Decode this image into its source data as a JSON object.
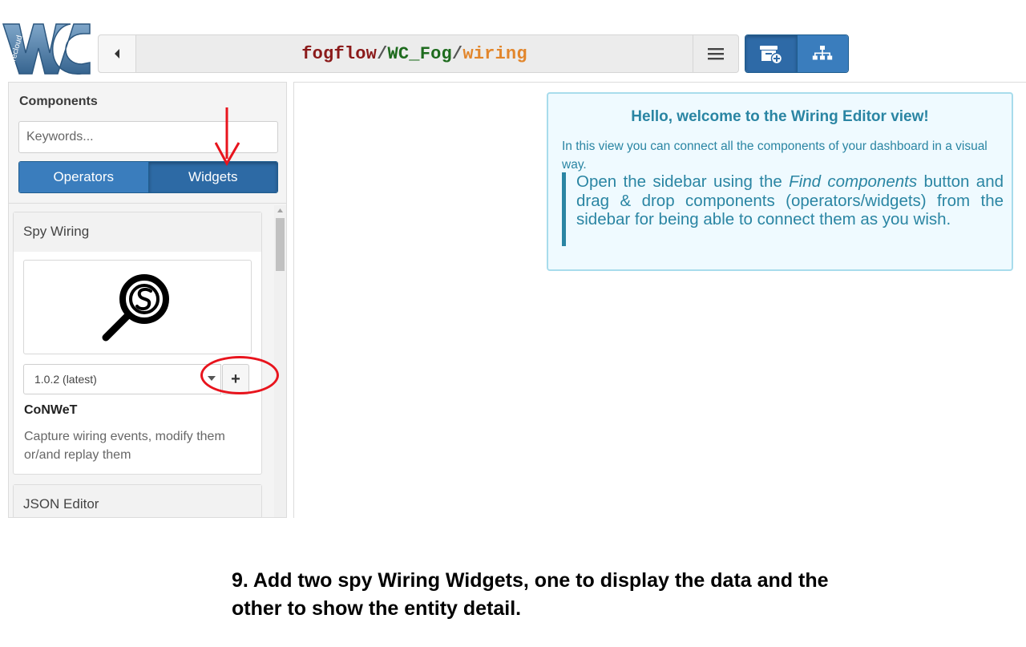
{
  "header": {
    "logo_text": "Wirecloud",
    "breadcrumb": {
      "user": "fogflow",
      "separator": "/",
      "workspace": "WC_Fog",
      "view": "wiring"
    },
    "back_icon": "caret-left-icon",
    "menu_icon": "hamburger-menu-icon",
    "tools": [
      {
        "name": "find-components",
        "icon": "archive-add-icon",
        "active": true
      },
      {
        "name": "behaviours",
        "icon": "sitemap-icon",
        "active": false
      }
    ]
  },
  "sidebar": {
    "title": "Components",
    "search": {
      "placeholder": "Keywords...",
      "value": ""
    },
    "tabs": [
      {
        "label": "Operators",
        "active": false
      },
      {
        "label": "Widgets",
        "active": true
      }
    ],
    "results": [
      {
        "title": "Spy Wiring",
        "icon": "spy-magnifier-icon",
        "version": "1.0.2 (latest)",
        "add_label": "+",
        "vendor": "CoNWeT",
        "description": "Capture wiring events, modify them or/and replay them"
      },
      {
        "title": "JSON Editor"
      }
    ]
  },
  "welcome": {
    "title": "Hello, welcome to the Wiring Editor view!",
    "text": "In this view you can connect all the components of your dashboard in a visual way.",
    "hint_before": "Open the sidebar using the ",
    "hint_em": "Find components",
    "hint_after": " button and drag & drop components (operators/widgets) from the sidebar for being able to connect them as you wish."
  },
  "caption": "9. Add two spy Wiring Widgets, one to display the data and the other to show the entity detail.",
  "colors": {
    "primary": "#3a7dbd",
    "primary_active": "#2d6aa5",
    "info_text": "#2a85a3",
    "info_bg": "#effaff",
    "annotation": "#e8141d"
  }
}
